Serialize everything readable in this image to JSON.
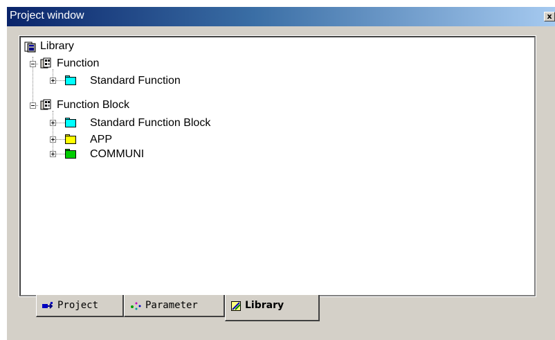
{
  "window": {
    "title": "Project window",
    "close_glyph": "x"
  },
  "tree": {
    "root": {
      "label": "Library",
      "icon": "library-icon"
    },
    "groups": [
      {
        "label": "Function",
        "icon": "function-group-icon",
        "expanded": true,
        "children": [
          {
            "label": "Standard Function",
            "folder_color": "#00ffff",
            "expanded": false
          }
        ]
      },
      {
        "label": "Function Block",
        "icon": "function-group-icon",
        "expanded": true,
        "children": [
          {
            "label": "Standard Function Block",
            "folder_color": "#00ffff",
            "expanded": false
          },
          {
            "label": "APP",
            "folder_color": "#ffff00",
            "expanded": false
          },
          {
            "label": "COMMUNI",
            "folder_color": "#00cc00",
            "expanded": false
          }
        ]
      }
    ]
  },
  "tabs": [
    {
      "label": "Project",
      "icon": "project-icon",
      "active": false
    },
    {
      "label": "Parameter",
      "icon": "parameter-icon",
      "active": false
    },
    {
      "label": "Library",
      "icon": "library-tab-icon",
      "active": true
    }
  ]
}
